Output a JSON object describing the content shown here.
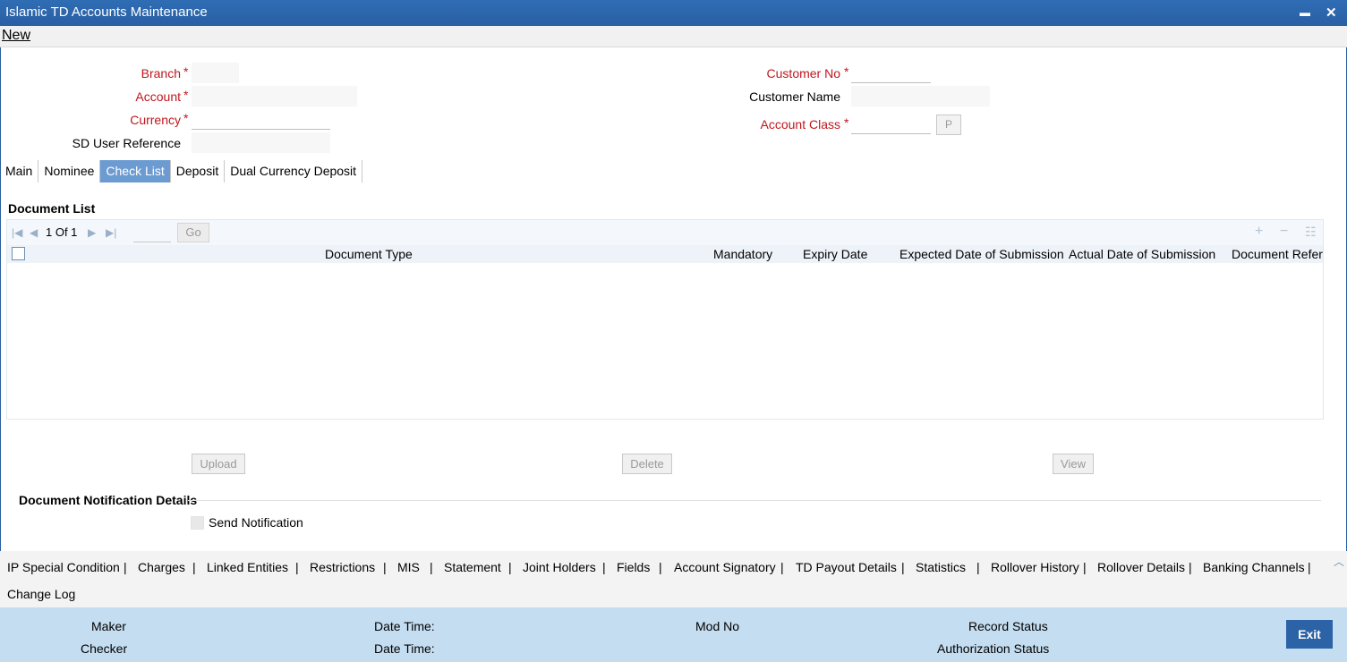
{
  "window": {
    "title": "Islamic TD Accounts Maintenance",
    "minimize": "▬",
    "close": "✕"
  },
  "menu": {
    "new": "New"
  },
  "header": {
    "branch": "Branch",
    "account": "Account",
    "currency": "Currency",
    "sd_user_reference": "SD User Reference",
    "customer_no": "Customer No",
    "customer_name": "Customer Name",
    "account_class": "Account Class",
    "lookup_button": "P",
    "required_mark": "*"
  },
  "tabs": [
    "Main",
    "Nominee",
    "Check List",
    "Deposit",
    "Dual Currency Deposit"
  ],
  "active_tab": "Check List",
  "document_list": {
    "title": "Document List",
    "pager": {
      "text": "1 Of 1",
      "go": "Go"
    },
    "columns": [
      "Document Type",
      "Mandatory",
      "Expiry Date",
      "Expected Date of Submission",
      "Actual Date of Submission",
      "Document Referen"
    ]
  },
  "buttons": {
    "upload": "Upload",
    "delete": "Delete",
    "view": "View"
  },
  "notification": {
    "title": "Document Notification Details",
    "send_notification": "Send Notification"
  },
  "footer_links": [
    "IP Special Condition",
    "Charges",
    "Linked Entities",
    "Restrictions",
    "MIS",
    "Statement",
    "Joint Holders",
    "Fields",
    "Account Signatory",
    "TD Payout Details",
    "Statistics",
    "Rollover History",
    "Rollover Details",
    "Banking Channels",
    "Change Log"
  ],
  "footer_separator": "|",
  "audit": {
    "maker": "Maker",
    "checker": "Checker",
    "date_time_1": "Date Time:",
    "date_time_2": "Date Time:",
    "mod_no": "Mod No",
    "record_status": "Record Status",
    "authorization_status": "Authorization Status",
    "exit": "Exit"
  },
  "colors": {
    "titlebar": "#2a5fa3",
    "required": "#c0161d",
    "active_tab": "#6c9bd2",
    "audit_bg": "#c4ddf0",
    "exit_button": "#2c62a6"
  }
}
